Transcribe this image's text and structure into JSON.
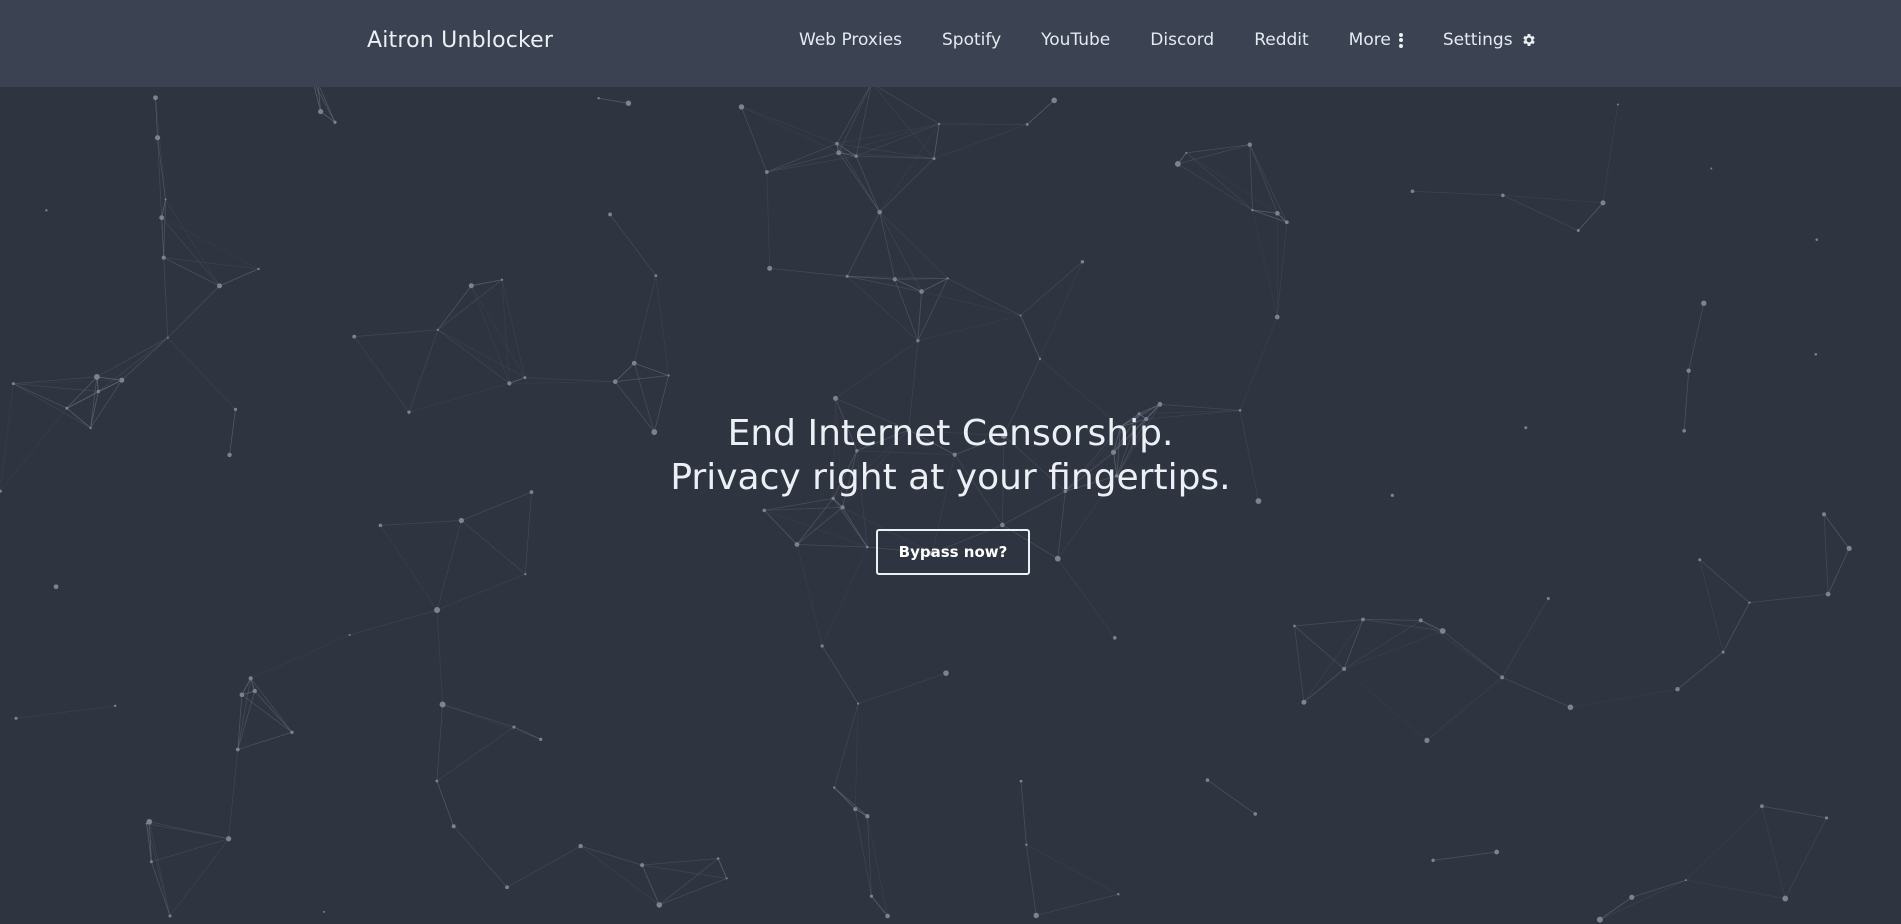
{
  "brand": {
    "title": "Aitron Unblocker"
  },
  "nav": {
    "items": [
      {
        "label": "Web Proxies"
      },
      {
        "label": "Spotify"
      },
      {
        "label": "YouTube"
      },
      {
        "label": "Discord"
      },
      {
        "label": "Reddit"
      },
      {
        "label": "More",
        "icon": "vertical-dots-icon"
      },
      {
        "label": "Settings",
        "icon": "gear-icon"
      }
    ]
  },
  "hero": {
    "line1": "End Internet Censorship.",
    "line2": "Privacy right at your fingertips.",
    "cta_label": "Bypass now?"
  },
  "colors": {
    "background": "#2e3440",
    "navbar": "#3b4252",
    "text": "#eceff4",
    "network_lines": "#6b7180",
    "network_nodes": "#7c828f"
  },
  "background": {
    "effect": "particle-network"
  }
}
